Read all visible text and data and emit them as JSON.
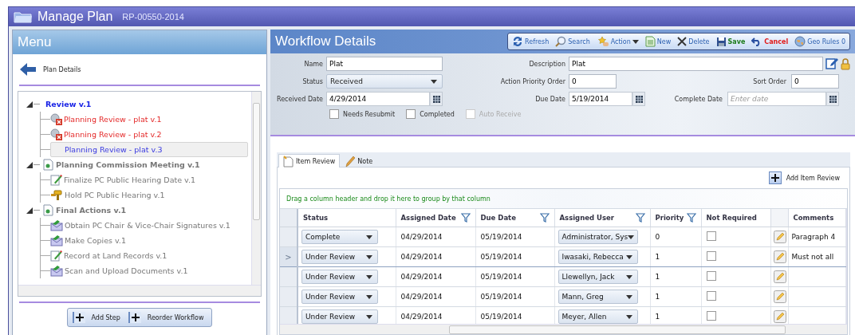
{
  "window": {
    "title": "Manage Plan",
    "record_id": "RP-00550-2014"
  },
  "menu": {
    "title": "Menu",
    "back_link": "Plan Details",
    "tree": [
      {
        "label": "Review v.1",
        "kind": "none",
        "current": true,
        "expanded": true,
        "children": [
          {
            "label": "Planning Review - plat v.1",
            "kind": "error",
            "selected": false
          },
          {
            "label": "Planning Review - plat v.2",
            "kind": "error",
            "selected": false
          },
          {
            "label": "Planning Review - plat v.3",
            "kind": "plain",
            "selected": true
          }
        ]
      },
      {
        "label": "Planning Commission Meeting v.1",
        "kind": "group",
        "current": false,
        "expanded": true,
        "children": [
          {
            "label": "Finalize PC Public Hearing Date v.1",
            "kind": "edit",
            "selected": false
          },
          {
            "label": "Hold PC Public Hearing v.1",
            "kind": "gavel",
            "selected": false
          }
        ]
      },
      {
        "label": "Final Actions v.1",
        "kind": "group",
        "current": false,
        "expanded": true,
        "children": [
          {
            "label": "Obtain PC Chair & Vice-Chair Signatures v.1",
            "kind": "mail",
            "selected": false
          },
          {
            "label": "Make Copies v.1",
            "kind": "mail",
            "selected": false
          },
          {
            "label": "Record at Land Records v.1",
            "kind": "edit",
            "selected": false
          },
          {
            "label": "Scan and Upload Documents v.1",
            "kind": "mail",
            "selected": false
          }
        ]
      }
    ],
    "buttons": [
      "Add Step",
      "Reorder Workflow"
    ]
  },
  "details": {
    "title": "Workflow Details",
    "toolbar": [
      {
        "label": "Refresh",
        "kind": "refresh"
      },
      {
        "label": "Search",
        "kind": "search"
      },
      {
        "label": "Action",
        "kind": "action"
      },
      {
        "label": "New",
        "kind": "new"
      },
      {
        "label": "Delete",
        "kind": "delete"
      },
      {
        "label": "Save",
        "kind": "save"
      },
      {
        "label": "Cancel",
        "kind": "cancel"
      },
      {
        "label": "Geo Rules 0",
        "kind": "geo"
      }
    ],
    "fields": {
      "name": {
        "label": "Name",
        "value": "Plat"
      },
      "description": {
        "label": "Description",
        "value": "Plat"
      },
      "status": {
        "label": "Status",
        "value": "Received"
      },
      "action_priority_order": {
        "label": "Action Priority Order",
        "value": "0"
      },
      "sort_order": {
        "label": "Sort Order",
        "value": "0"
      },
      "received_date": {
        "label": "Received Date",
        "value": "4/29/2014"
      },
      "due_date": {
        "label": "Due Date",
        "value": "5/19/2014"
      },
      "complete_date": {
        "label": "Complete Date",
        "placeholder": "Enter date"
      }
    },
    "checkboxes": [
      {
        "label": "Needs Resubmit",
        "checked": false,
        "disabled": false
      },
      {
        "label": "Completed",
        "checked": false,
        "disabled": false
      },
      {
        "label": "Auto Receive",
        "checked": false,
        "disabled": true
      }
    ],
    "tabs": [
      {
        "label": "Item Review",
        "selected": true,
        "kind": "page"
      },
      {
        "label": "Note",
        "selected": false,
        "kind": "pencil"
      }
    ],
    "add_button": "Add Item Review",
    "group_hint": "Drag a column header and drop it here to group by that column",
    "table": {
      "columns": [
        {
          "label": "Status",
          "filter": false
        },
        {
          "label": "Assigned Date",
          "filter": true
        },
        {
          "label": "Due Date",
          "filter": true
        },
        {
          "label": "Assigned User",
          "filter": true
        },
        {
          "label": "Priority",
          "filter": true
        },
        {
          "label": "Not Required",
          "filter": false
        },
        {
          "kind": "edit"
        },
        {
          "label": "Comments",
          "filter": false
        }
      ],
      "rows": [
        {
          "status": "Complete",
          "assigned_date": "04/29/2014",
          "due_date": "05/19/2014",
          "user": "Administrator, Sys",
          "priority": "0",
          "not_required": false,
          "comments": "Paragraph 4",
          "current": false
        },
        {
          "status": "Under Review",
          "assigned_date": "04/29/2014",
          "due_date": "05/19/2014",
          "user": "Iwasaki, Rebecca",
          "priority": "1",
          "not_required": false,
          "comments": "Must not all",
          "current": true,
          "marker": ">"
        },
        {
          "status": "Under Review",
          "assigned_date": "04/29/2014",
          "due_date": "05/19/2014",
          "user": "Llewellyn, Jack",
          "priority": "1",
          "not_required": false,
          "current": false
        },
        {
          "status": "Under Review",
          "assigned_date": "04/29/2014",
          "due_date": "05/19/2014",
          "user": "Mann, Greg",
          "priority": "1",
          "not_required": false,
          "current": false
        },
        {
          "status": "Under Review",
          "assigned_date": "04/29/2014",
          "due_date": "05/19/2014",
          "user": "Meyer, Allen",
          "priority": "1",
          "not_required": false,
          "current": false
        }
      ]
    }
  }
}
